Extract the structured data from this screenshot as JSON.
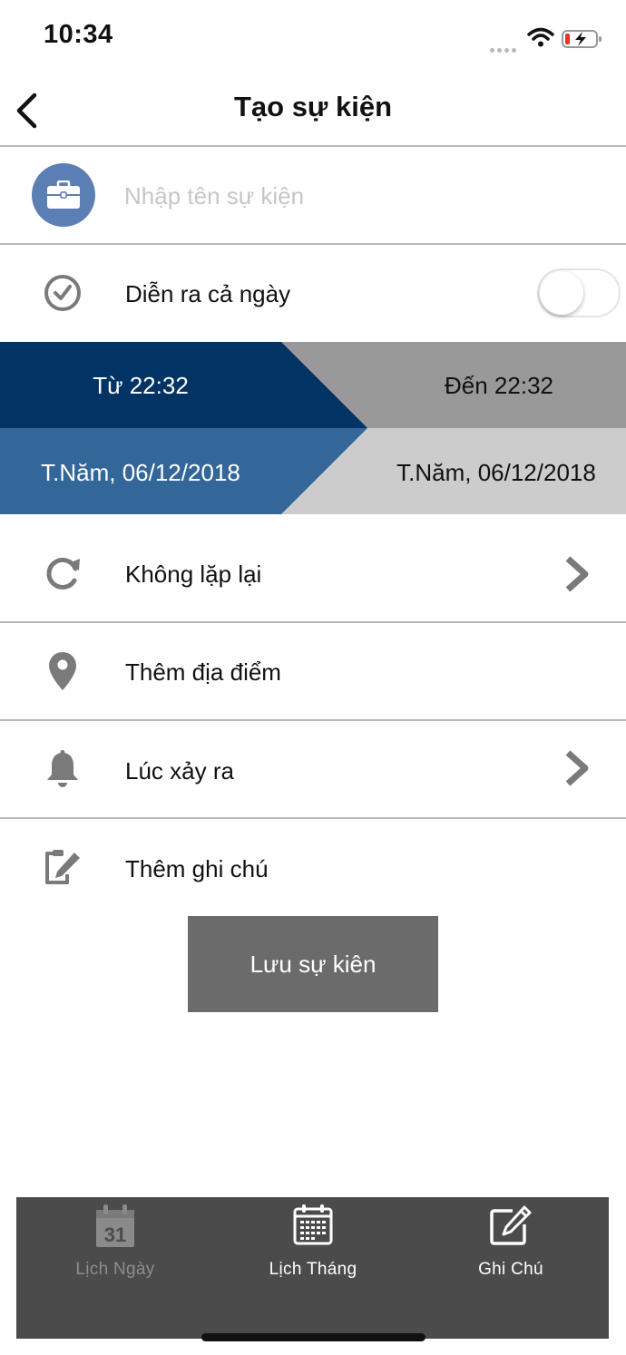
{
  "status_bar": {
    "time": "10:34"
  },
  "header": {
    "title": "Tạo sự kiện"
  },
  "event_name": {
    "placeholder": "Nhập tên sự kiện",
    "value": ""
  },
  "all_day": {
    "label": "Diễn ra cả ngày",
    "enabled": false
  },
  "time_range": {
    "from_time": "Từ 22:32",
    "to_time": "Đến 22:32",
    "from_date": "T.Năm, 06/12/2018",
    "to_date": "T.Năm, 06/12/2018"
  },
  "options": {
    "repeat": "Không lặp lại",
    "location": "Thêm địa điểm",
    "reminder": "Lúc xảy ra",
    "note": "Thêm ghi chú"
  },
  "save_label": "Lưu sự kiên",
  "tabs": [
    {
      "label": "Lịch Ngày",
      "icon": "calendar-day-icon",
      "active": false,
      "day": "31"
    },
    {
      "label": "Lịch Tháng",
      "icon": "calendar-month-icon",
      "active": true
    },
    {
      "label": "Ghi Chú",
      "icon": "edit-note-icon",
      "active": true
    }
  ],
  "colors": {
    "from_dark": "#023365",
    "from_light": "#336699",
    "to_dark": "#999999",
    "to_light": "#cccccc",
    "avatar_bg": "#5b7fb4",
    "save_bg": "#6b6b6b",
    "tabbar_bg": "#4b4b4b"
  }
}
